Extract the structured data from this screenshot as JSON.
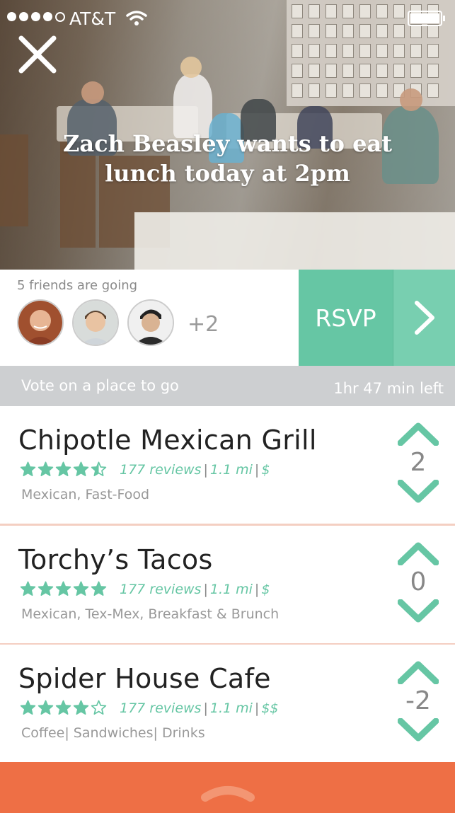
{
  "status_bar": {
    "carrier": "AT&T"
  },
  "hero": {
    "headline": "Zach Beasley wants to eat lunch today at 2pm"
  },
  "friends": {
    "label": "5 friends are going",
    "more": "+2"
  },
  "rsvp": {
    "label": "RSVP"
  },
  "vote_bar": {
    "title": "Vote on a place to go",
    "time_left": "1hr 47 min left"
  },
  "places": [
    {
      "name": "Chipotle Mexican Grill",
      "rating": 4.5,
      "reviews": "177 reviews",
      "distance": "1.1 mi",
      "price": "$",
      "categories": "Mexican, Fast-Food",
      "votes": "2"
    },
    {
      "name": "Torchy’s Tacos",
      "rating": 5,
      "reviews": "177 reviews",
      "distance": "1.1 mi",
      "price": "$",
      "categories": "Mexican, Tex-Mex, Breakfast & Brunch",
      "votes": "0"
    },
    {
      "name": "Spider House Cafe",
      "rating": 4,
      "reviews": "177 reviews",
      "distance": "1.1 mi",
      "price": "$$",
      "categories": "Coffee| Sandwiches| Drinks",
      "votes": "-2"
    }
  ],
  "colors": {
    "accent": "#66c6a4",
    "bottom_bar": "#ee6f45",
    "divider": "#f4cfc2"
  },
  "icons": [
    "close-icon",
    "wifi-icon",
    "battery-icon",
    "chevron-right-icon",
    "upvote-icon",
    "downvote-icon",
    "star-icon",
    "drawer-handle-icon"
  ]
}
